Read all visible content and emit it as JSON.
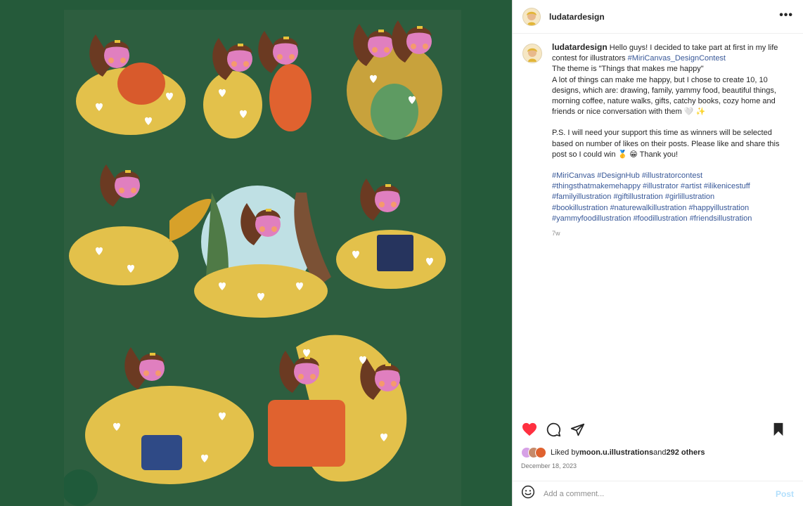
{
  "post": {
    "username": "ludatardesign",
    "more_icon": "more-horizontal-icon"
  },
  "caption": {
    "username": "ludatardesign",
    "line1": "Hello guys! I decided to take part at first in my life contest for illustrators ",
    "contest_tag": "#MiriCanvas_DesignContest",
    "theme": "The theme is \"Things that makes me happy\"",
    "body": "A lot of things can make me happy, but I chose to create 10, 10 designs, which are: drawing, family, yammy food, beautiful things, morning coffee, nature walks, gifts, catchy books, cozy home and friends or nice conversation with them 🤍 ✨",
    "ps": "P.S. I will need your support this time as winners will be selected based on number of likes on their posts. Please like and share this post so I could win 🥇 😁 Thank you!",
    "hashtags": [
      "#MiriCanvas",
      "#DesignHub",
      "#illustratorcontest",
      "#thingsthatmakemehappy",
      "#illustrator",
      "#artist",
      "#ilikenicestuff",
      "#familyillustration",
      "#giftillustration",
      "#girlillustration",
      "#bookillustration",
      "#naturewalkillustration",
      "#happyillustration",
      "#yammyfoodillustration",
      "#foodillustration",
      "#friendsillustration"
    ],
    "age": "7w"
  },
  "actions": {
    "like_icon": "heart-filled-icon",
    "comment_icon": "comment-icon",
    "share_icon": "share-icon",
    "save_icon": "bookmark-filled-icon"
  },
  "likes": {
    "prefix": "Liked by ",
    "user": "moon.u.illustrations",
    "middle": " and ",
    "others": "292 others"
  },
  "date": "December 18, 2023",
  "comment": {
    "emoji_icon": "emoji-icon",
    "placeholder": "Add a comment...",
    "post_label": "Post"
  },
  "colors": {
    "background_green": "#255a3a",
    "like_red": "#ff3040",
    "hashtag_blue": "#385898",
    "post_disabled": "#b2dffc"
  }
}
